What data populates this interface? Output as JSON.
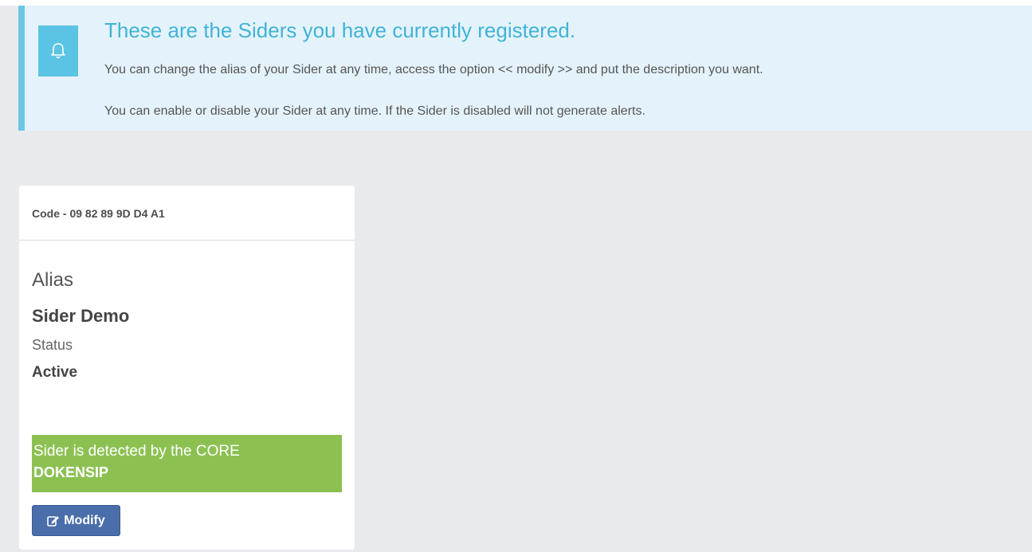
{
  "alert": {
    "icon": "bell-icon",
    "title": "These are the Siders you have currently registered.",
    "line1": "You can change the alias of your Sider at any time, access the option << modify >> and put the description you want.",
    "line2": "You can enable or disable your Sider at any time. If the Sider is disabled will not generate alerts.",
    "title_color": "#41b3d6",
    "background": "#e4f3fb",
    "border_color": "#6fc6e3"
  },
  "card": {
    "code": "Code - 09 82 89 9D D4 A1",
    "alias_label": "Alias",
    "alias_value": "Sider Demo",
    "status_label": "Status",
    "status_value": "Active",
    "detection": {
      "line1": "Sider is detected by the CORE",
      "line2": "DOKENSIP",
      "background": "#8cc152"
    },
    "modify_button": {
      "icon": "edit-icon",
      "label": "Modify",
      "background": "#4a6ea9"
    }
  }
}
